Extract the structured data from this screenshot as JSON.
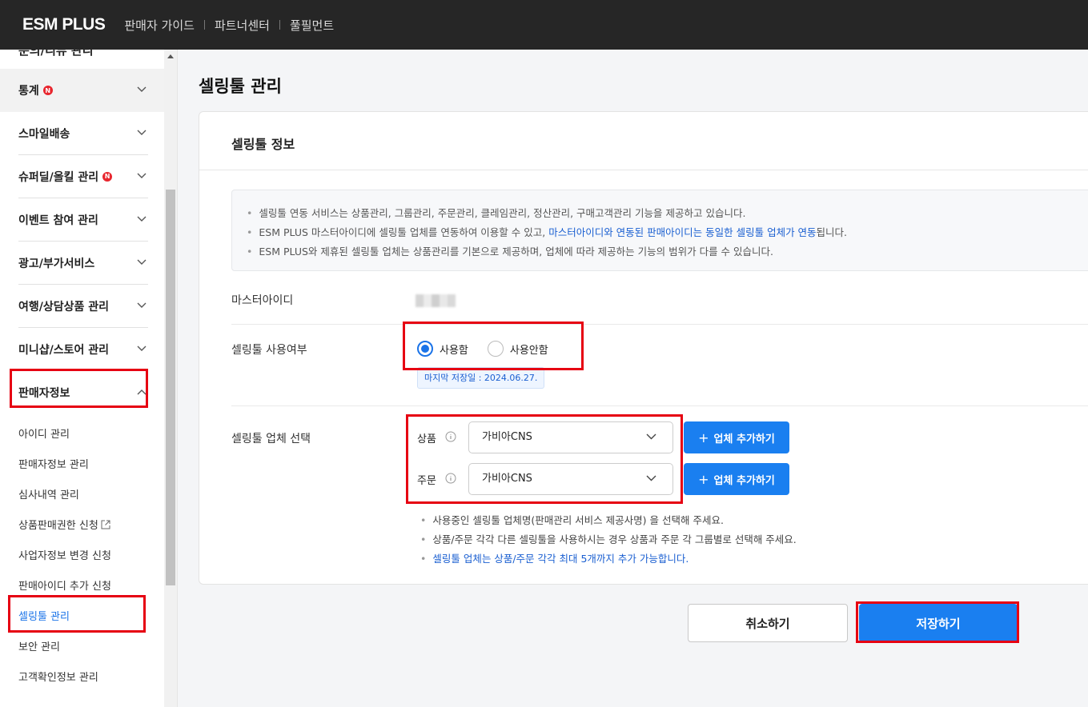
{
  "header": {
    "logo": "ESM PLUS",
    "links": [
      "판매자 가이드",
      "파트너센터",
      "풀필먼트"
    ]
  },
  "sidebar": {
    "clipped_item": "문의/리뷰 관리",
    "menus": [
      {
        "label": "통계",
        "badge": "N"
      },
      {
        "label": "스마일배송"
      },
      {
        "label": "슈퍼딜/올킬 관리",
        "badge": "N"
      },
      {
        "label": "이벤트 참여 관리"
      },
      {
        "label": "광고/부가서비스"
      },
      {
        "label": "여행/상담상품 관리"
      },
      {
        "label": "미니샵/스토어 관리"
      },
      {
        "label": "판매자정보"
      }
    ],
    "submenu": [
      "아이디 관리",
      "판매자정보 관리",
      "심사내역 관리",
      "상품판매권한 신청",
      "사업자정보 변경 신청",
      "판매아이디 추가 신청",
      "셀링툴 관리",
      "보안 관리",
      "고객확인정보 관리"
    ]
  },
  "main": {
    "page_title": "셀링툴 관리",
    "card_title": "셀링툴 정보",
    "notice": {
      "line1": "셀링툴 연동 서비스는 상품관리, 그룹관리, 주문관리, 클레임관리, 정산관리, 구매고객관리 기능을 제공하고 있습니다.",
      "line2_pre": "ESM PLUS 마스터아이디에 셀링툴 업체를 연동하여 이용할 수 있고, ",
      "line2_hl": "마스터아이디와 연동된 판매아이디는 동일한 셀링툴 업체가 연동",
      "line2_post": "됩니다.",
      "line3": "ESM PLUS와 제휴된 셀링툴 업체는 상품관리를 기본으로 제공하며, 업체에 따라 제공하는 기능의 범위가 다를 수 있습니다."
    },
    "master_id_label": "마스터아이디",
    "usage_label": "셀링툴 사용여부",
    "usage_options": [
      "사용함",
      "사용안함"
    ],
    "usage_selected": "사용함",
    "last_saved": "마지막 저장일 : 2024.06.27.",
    "vendor_label": "셀링툴 업체 선택",
    "vendor_rows": [
      {
        "label": "상품",
        "value": "가비아CNS",
        "button": "업체 추가하기"
      },
      {
        "label": "주문",
        "value": "가비아CNS",
        "button": "업체 추가하기"
      }
    ],
    "hints": [
      "사용중인 셀링툴 업체명(판매관리 서비스 제공사명) 을 선택해 주세요.",
      "상품/주문 각각 다른 셀링툴을 사용하시는 경우 상품과 주문 각 그룹별로 선택해 주세요.",
      "셀링툴 업체는 상품/주문 각각 최대 5개까지 추가 가능합니다."
    ],
    "cancel_label": "취소하기",
    "save_label": "저장하기"
  },
  "colors": {
    "accent": "#1a7ff0",
    "header_bg": "#262626",
    "highlight_box": "#e60012"
  }
}
